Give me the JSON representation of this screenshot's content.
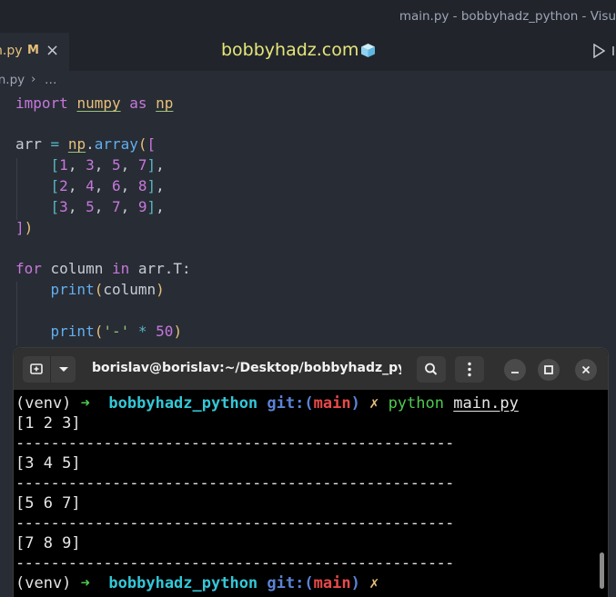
{
  "window_title": "main.py - bobbyhadz_python - Visu",
  "tab": {
    "label": "n.py",
    "modified": "M",
    "close": "×"
  },
  "brand": {
    "text": "bobbyhadz.com"
  },
  "breadcrumb": {
    "file": "in.py",
    "sep": "›",
    "more": "…"
  },
  "code": {
    "l1": {
      "kw1": "import",
      "mod1": "numpy",
      "kw2": "as",
      "mod2": "np"
    },
    "l3": {
      "var": "arr",
      "eq": "=",
      "mod": "np",
      "dot": ".",
      "fn": "array",
      "open": "(",
      "bracket": "["
    },
    "rows": [
      {
        "open": "[",
        "n1": "1",
        "n2": "3",
        "n3": "5",
        "n4": "7",
        "close": "]",
        "comma": ","
      },
      {
        "open": "[",
        "n1": "2",
        "n2": "4",
        "n3": "6",
        "n4": "8",
        "close": "]",
        "comma": ","
      },
      {
        "open": "[",
        "n1": "3",
        "n2": "5",
        "n3": "7",
        "n4": "9",
        "close": "]",
        "comma": ","
      }
    ],
    "l7": {
      "bracket": "]",
      "paren": ")"
    },
    "l9": {
      "kw1": "for",
      "var": "column",
      "kw2": "in",
      "expr": "arr.T:"
    },
    "l10": {
      "fn": "print",
      "open": "(",
      "arg": "column",
      "close": ")"
    },
    "l12": {
      "fn": "print",
      "open": "(",
      "str": "'-'",
      "op": "*",
      "num": "50",
      "close": ")"
    }
  },
  "terminal": {
    "title": "borislav@borislav:~/Desktop/bobbyhadz_pyt...",
    "prompt": {
      "venv": "(venv)",
      "arrow": "➜",
      "dir": "bobbyhadz_python",
      "git": "git:(",
      "branch": "main",
      "git_close": ")",
      "dirty": "✗"
    },
    "command": "python",
    "argument": "main.py",
    "output": [
      "[1 2 3]",
      "--------------------------------------------------",
      "[3 4 5]",
      "--------------------------------------------------",
      "[5 6 7]",
      "--------------------------------------------------",
      "[7 8 9]",
      "--------------------------------------------------"
    ]
  },
  "icons": {
    "run": "play-icon",
    "new_tab": "new-tab-icon",
    "menu": "chevron-down-icon",
    "search": "search-icon",
    "kebab": "kebab-menu-icon",
    "minimize": "minimize-icon",
    "maximize": "maximize-icon",
    "close": "close-icon"
  },
  "colors": {
    "editor_bg": "#282c34",
    "keyword": "#c678dd",
    "module": "#e5c07b",
    "function": "#61afef",
    "string": "#98c379",
    "terminal_bg": "#000000",
    "prompt_arrow": "#4ec94e",
    "prompt_dir": "#34c7d7",
    "branch": "#e84a4a"
  }
}
